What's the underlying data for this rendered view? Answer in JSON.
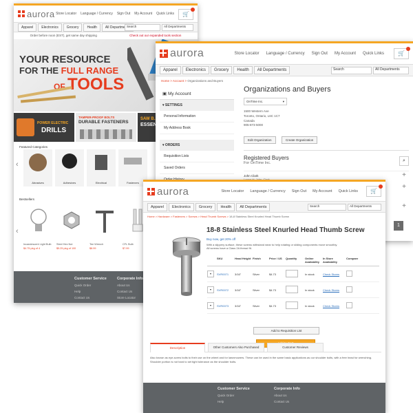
{
  "brand": {
    "name": "aurora",
    "accent": "#e63c1e",
    "orange": "#f5a623"
  },
  "utility": [
    "Store Locator",
    "Language / Currency",
    "Sign Out",
    "My Account",
    "Quick Links"
  ],
  "nav": [
    "Apparel",
    "Electronics",
    "Grocery",
    "Health",
    "All Departments"
  ],
  "search": {
    "placeholder": "Search",
    "department": "All Departments"
  },
  "home": {
    "notice_left": "Order before noon (EST), get same day shipping",
    "notice_right": "Check out our expanded tools section",
    "hero_l1": "YOUR RESOURCE",
    "hero_l2a": "FOR THE ",
    "hero_l2b": "FULL RANGE",
    "hero_l3a": "OF ",
    "hero_l3b": "TOOLS",
    "promo1_a": "POWER ELECTRIC",
    "promo1_b": "DRILLS",
    "promo2_a": "TAMPER-PROOF BOLTS",
    "promo2_b": "DURABLE FASTENERS",
    "promo3_a": "SAW B...",
    "promo3_b": "ESSEN...",
    "featured_title": "Featured Categories",
    "categories": [
      "Abrasives",
      "Adhesives",
      "Electrical",
      "Fasteners"
    ],
    "bestsellers_title": "Bestsellers",
    "products": [
      {
        "name": "Incandescent Light Bulb",
        "price": "$4.75 pkg of 4"
      },
      {
        "name": "Steel Hex Nut",
        "price": "$5.25 pkg of 100"
      },
      {
        "name": "Tee Wrench",
        "price": "$8.99"
      },
      {
        "name": "CFL Bulb",
        "price": "$7.99"
      }
    ],
    "footer_cs": "Customer Service",
    "footer_ci": "Corporate Info",
    "footer_cs_links": [
      "Quick Order",
      "Help",
      "Contact Us"
    ],
    "footer_ci_links": [
      "About Us",
      "Contact Us",
      "Store Locator"
    ]
  },
  "org": {
    "bread": [
      "Home",
      "Account",
      "Organizations and Buyers"
    ],
    "my_account": "My Account",
    "settings_label": "SETTINGS",
    "settings_items": [
      "Personal Information",
      "My Address Book"
    ],
    "orders_label": "ORDERS",
    "orders_items": [
      "Requisition Lists",
      "Saved Orders",
      "Order History"
    ],
    "title": "Organizations and Buyers",
    "select_value": "OnTime Inc.",
    "address": [
      "1500 Western Ave",
      "Toronto, Ontario, L6C 1C7",
      "Canada",
      "905-873-5000"
    ],
    "btn_edit": "Edit Organization",
    "btn_create": "Create Organization",
    "buyers_title": "Registered Buyers",
    "buyers_sub": "For OnTime Inc.",
    "buyer_name": "John Clark",
    "buyer_logon": "Logon id: John_Clark",
    "page_num": "1"
  },
  "product": {
    "bread": [
      "Home",
      "Hardware",
      "Fasteners",
      "Screws",
      "Head Thumb Screws"
    ],
    "bread_cur": "18-8 Stainless Steel Knurled Head Thumb Screw",
    "title": "18-8 Stainless Steel Knurled Head Thumb Screw",
    "promo": "Buy now, get 20% off",
    "desc1": "With a slippery surface, these screws withstand wear to help rotating or sliding components move smoothly.",
    "desc2": "All screws have a Class 2A thread fit.",
    "headers": [
      "SKU",
      "Head Height",
      "Finish",
      "Price / US",
      "Quantity",
      "Online Availability",
      "In Store Availability",
      "Compare"
    ],
    "rows": [
      {
        "sku": "SVR0071",
        "height": "3/16\"",
        "finish": "Silver",
        "price": "$4.73",
        "online": "In stock",
        "store": "Check Stores"
      },
      {
        "sku": "SVR0072",
        "height": "3/16\"",
        "finish": "Silver",
        "price": "$4.73",
        "online": "In stock",
        "store": "Check Stores"
      },
      {
        "sku": "SVR0073",
        "height": "3/16\"",
        "finish": "Silver",
        "price": "$4.73",
        "online": "In stock",
        "store": "Check Stores"
      }
    ],
    "btn_req": "Add to Requisition List",
    "btn_cart": "Add to Cart",
    "tabs": [
      "Description",
      "Other Customers Also Purchased",
      "Customer Reviews"
    ],
    "desc_body": "Also known as eye-screw bolts to their use on the wheel and for lawnmowers. These can be used in the same basic applications as our shoulder bolts, with a free head for wrenching. Shoulder portion is not hard to set tight tolerance as the shoulder bolts.",
    "footer_cs": "Customer Service",
    "footer_ci": "Corporate Info",
    "footer_cs_links": [
      "Quick Order",
      "Help"
    ],
    "footer_ci_links": [
      "About Us",
      "Contact Us"
    ]
  }
}
